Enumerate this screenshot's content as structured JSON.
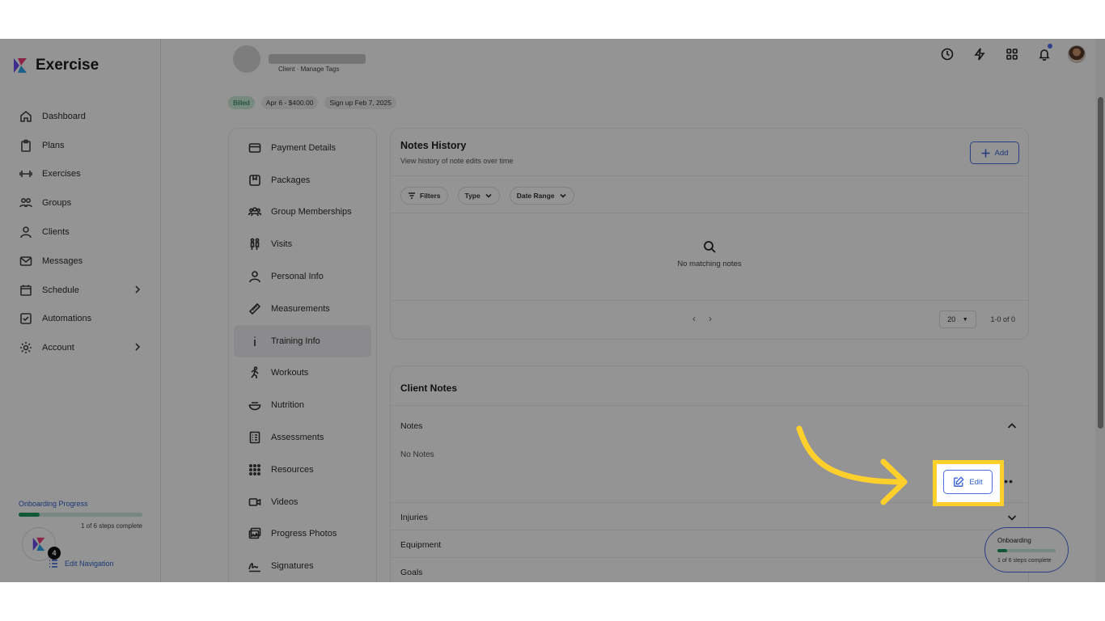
{
  "app": {
    "name": "Exercise"
  },
  "sidebar": {
    "items": [
      {
        "label": "Dashboard",
        "icon": "home-icon"
      },
      {
        "label": "Plans",
        "icon": "clipboard-icon"
      },
      {
        "label": "Exercises",
        "icon": "dumbbell-icon"
      },
      {
        "label": "Groups",
        "icon": "users-icon"
      },
      {
        "label": "Clients",
        "icon": "user-icon"
      },
      {
        "label": "Messages",
        "icon": "mail-icon"
      },
      {
        "label": "Schedule",
        "icon": "calendar-icon"
      },
      {
        "label": "Automations",
        "icon": "check-square-icon"
      },
      {
        "label": "Account",
        "icon": "gear-icon"
      }
    ],
    "onboarding": {
      "title": "Onboarding Progress",
      "steps": "1 of 6 steps complete",
      "progress": 0.17,
      "count": "4"
    },
    "edit_nav": "Edit Navigation"
  },
  "client": {
    "sub": "Client · Manage Tags",
    "badges": [
      "Billed",
      "Apr 6 - $400.00",
      "Sign up Feb 7, 2025"
    ]
  },
  "submenu": {
    "items": [
      "Payment Details",
      "Packages",
      "Group Memberships",
      "Visits",
      "Personal Info",
      "Measurements",
      "Training Info",
      "Workouts",
      "Nutrition",
      "Assessments",
      "Resources",
      "Videos",
      "Progress Photos",
      "Signatures"
    ],
    "active": "Training Info"
  },
  "notes_history": {
    "title": "Notes History",
    "subtitle": "View history of note edits over time",
    "add_label": "Add",
    "filters": [
      "Filters",
      "Type",
      "Date Range"
    ],
    "empty": "No matching notes",
    "page_size": "20",
    "range": "1-0 of 0"
  },
  "client_notes": {
    "title": "Client Notes",
    "sections": [
      "Notes",
      "Injuries",
      "Equipment",
      "Goals"
    ],
    "no_notes": "No Notes",
    "edit_label": "Edit"
  },
  "floating_onboarding": {
    "title": "Onboarding",
    "steps": "1 of 6 steps complete",
    "progress": 0.17
  },
  "colors": {
    "accent": "#2f5fd0",
    "highlight": "#ffd02b",
    "success": "#1e9a5e"
  }
}
